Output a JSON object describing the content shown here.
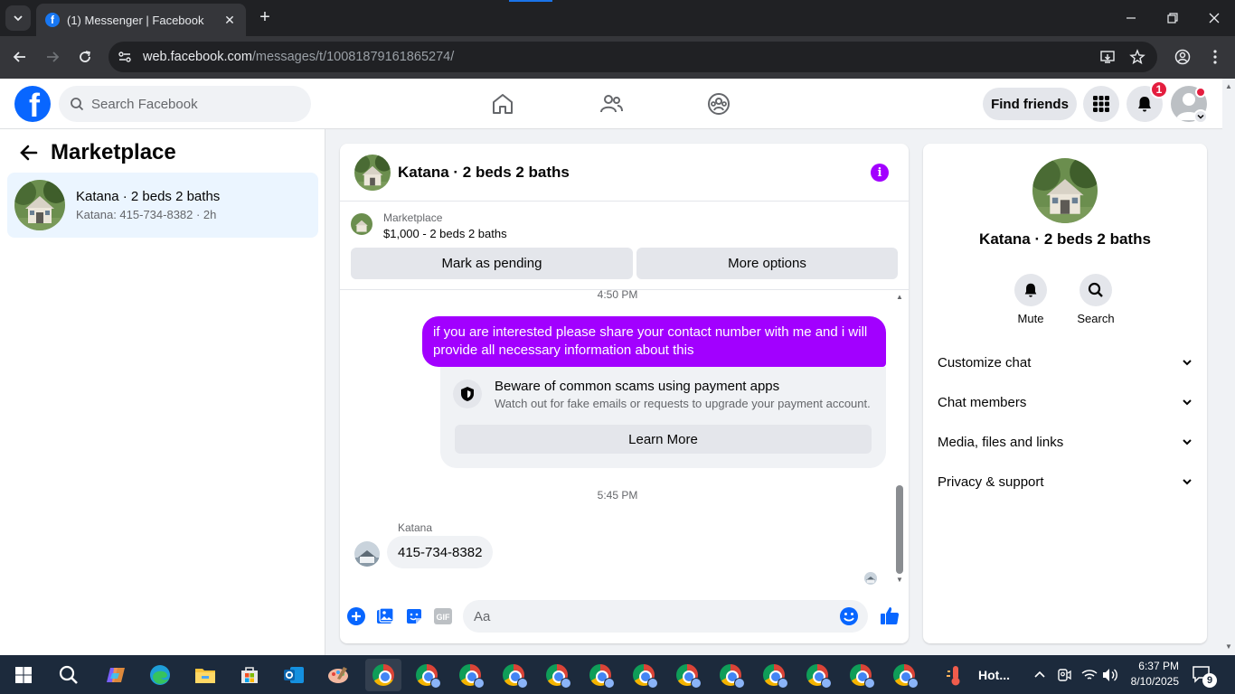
{
  "browser": {
    "tab_title": "(1) Messenger | Facebook",
    "tab_favicon": "f",
    "url_host": "web.facebook.com",
    "url_path": "/messages/t/10081879161865274/"
  },
  "header": {
    "search_placeholder": "Search Facebook",
    "find_friends_label": "Find friends",
    "notification_count": "1",
    "logo_letter": "f"
  },
  "sidebar": {
    "title": "Marketplace",
    "conversations": [
      {
        "title": "Katana · 2 beds 2 baths",
        "subtitle": "Katana: 415-734-8382 · 2h"
      }
    ]
  },
  "chat": {
    "title": "Katana · 2 beds 2 baths",
    "info_icon": "i",
    "marketplace_label": "Marketplace",
    "listing_price": "$1,000 - 2 beds 2 baths",
    "mark_pending_label": "Mark as pending",
    "more_options_label": "More options",
    "time_1": "4:50 PM",
    "outgoing_message": "if you are interested please share your contact number with me and i will provide all necessary information about this",
    "scam_title": "Beware of common scams using payment apps",
    "scam_subtitle": "Watch out for fake emails or requests to upgrade your payment account.",
    "learn_more_label": "Learn More",
    "time_2": "5:45 PM",
    "sender_name": "Katana",
    "incoming_message": "415-734-8382",
    "composer_placeholder": "Aa"
  },
  "details": {
    "name": "Katana · 2 beds 2 baths",
    "mute_label": "Mute",
    "search_label": "Search",
    "sections": [
      "Customize chat",
      "Chat members",
      "Media, files and links",
      "Privacy & support"
    ]
  },
  "taskbar": {
    "weather_text": "Hot...",
    "time": "6:37 PM",
    "date": "8/10/2025",
    "notification_count": "9"
  },
  "colors": {
    "accent": "#a200ff",
    "fb_blue": "#0866ff",
    "badge_red": "#e41e3f"
  }
}
